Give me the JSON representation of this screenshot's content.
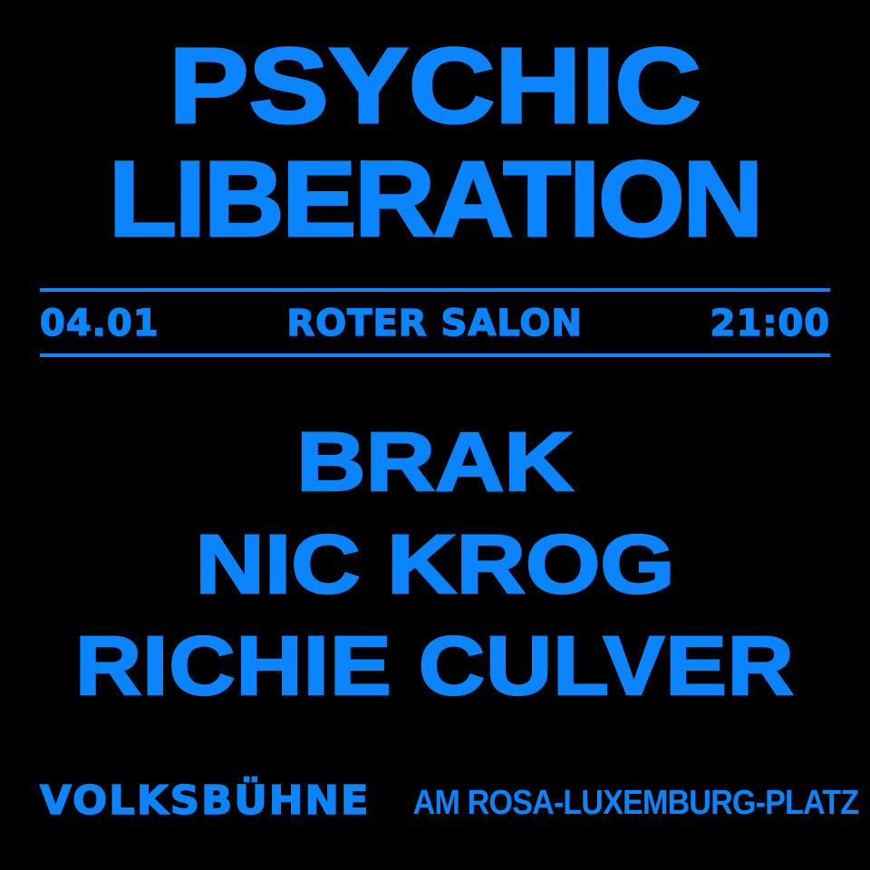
{
  "colors": {
    "background": "#000000",
    "accent": "#0a84ff"
  },
  "title": {
    "line1": "PSYCHIC",
    "line2": "LIBERATION"
  },
  "event": {
    "date": "04.01",
    "room": "ROTER SALON",
    "time": "21:00"
  },
  "artists": [
    "BRAK",
    "NIC KROG",
    "RICHIE CULVER"
  ],
  "venue": {
    "name": "VOLKSBÜHNE",
    "address": "AM ROSA-LUXEMBURG-PLATZ"
  }
}
